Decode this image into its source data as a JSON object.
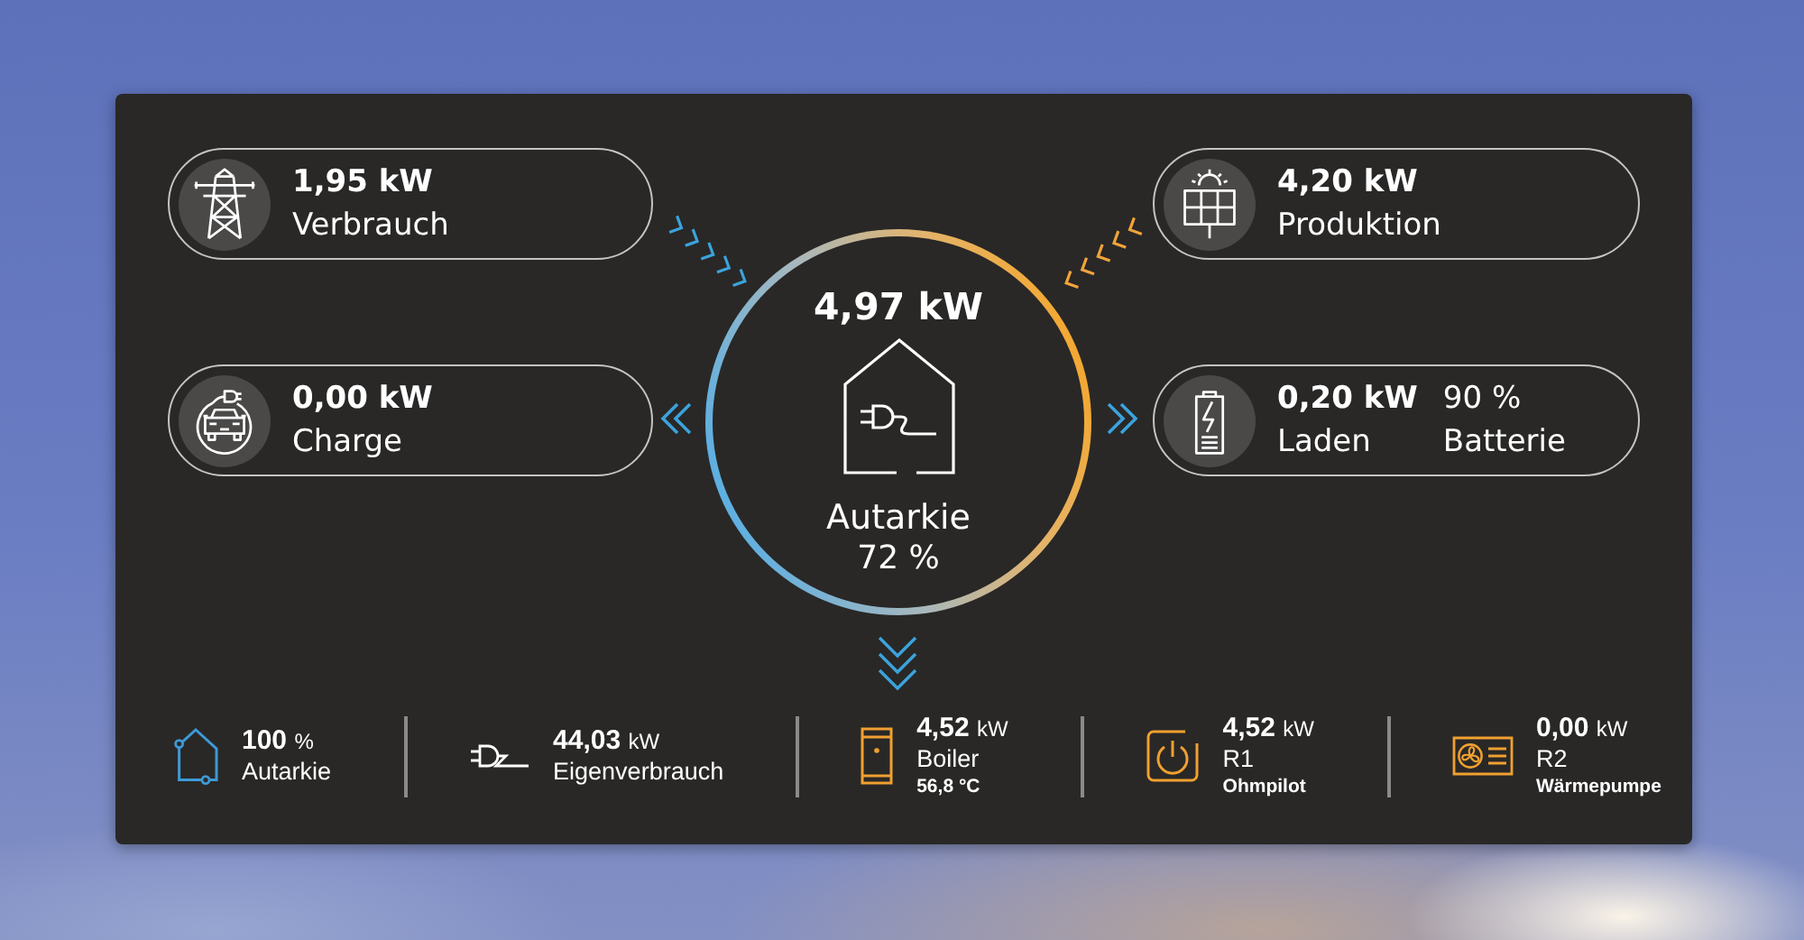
{
  "cards": [
    {
      "readings": [
        {
          "value": "1,95 kW",
          "label": "Verbrauch"
        }
      ],
      "incoming": true,
      "color": "#3ba3dc"
    },
    {
      "readings": [
        {
          "value": "4,20 kW",
          "label": "Produktion"
        }
      ],
      "incoming": true,
      "color": "#f2a33a"
    },
    {
      "readings": [
        {
          "value": "0,00 kW",
          "label": "Charge"
        }
      ],
      "incoming": false,
      "color": "#3ba3dc"
    },
    {
      "readings": [
        {
          "value": "0,20 kW",
          "label": "Laden"
        },
        {
          "value": "90 %",
          "label": "Batterie"
        }
      ],
      "incoming": false,
      "color": "#3ba3dc"
    }
  ],
  "center": {
    "power": "4,97 kW",
    "label": "Autarkie",
    "reading": "72 %",
    "incoming": false
  },
  "summary": [
    {
      "value": "100",
      "unit": "%",
      "label": "Autarkie",
      "color": "#3d9ad6"
    },
    {
      "value": "44,03",
      "unit": "kW",
      "label": "Eigenverbrauch",
      "color": "#ffffff"
    },
    {
      "value": "4,52",
      "unit": "kW",
      "label": "Boiler",
      "detail": "56,8 °C",
      "color": "#f0a030"
    },
    {
      "value": "4,52",
      "unit": "kW",
      "label": "R1",
      "detail": "Ohmpilot",
      "color": "#f0a030"
    },
    {
      "value": "0,00",
      "unit": "kW",
      "label": "R2",
      "detail": "Wärmepumpe",
      "color": "#f0a030"
    }
  ]
}
